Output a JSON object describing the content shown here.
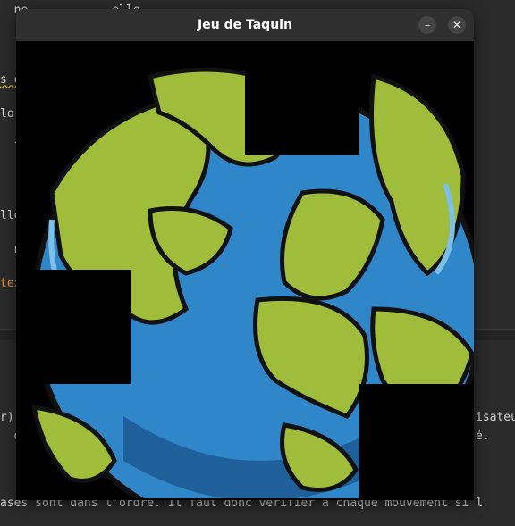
{
  "window": {
    "title": "Jeu de Taquin",
    "minimize_label": "–",
    "close_label": "✕"
  },
  "background_editor": {
    "lines": [
      "  ne            elle                ",
      "s é",
      "lor",
      "  la",
      "lle",
      "  ne",
      "tex",
      "r)",
      "  de",
      "isateu",
      "é.",
      "ases sont dans l'ordre. Il faut donc vérifier à chaque mouvement si l"
    ]
  },
  "board": {
    "grid": 4,
    "empty_index": 15,
    "tiles": [
      {
        "label": "tile-1"
      },
      {
        "label": "tile-2"
      },
      {
        "label": "tile-3"
      },
      {
        "label": "tile-4"
      },
      {
        "label": "tile-5"
      },
      {
        "label": "tile-6"
      },
      {
        "label": "tile-7"
      },
      {
        "label": "tile-8"
      },
      {
        "label": "tile-9"
      },
      {
        "label": "tile-10"
      },
      {
        "label": "tile-11"
      },
      {
        "label": "tile-12"
      },
      {
        "label": "tile-13"
      },
      {
        "label": "tile-14"
      },
      {
        "label": "tile-15"
      }
    ]
  },
  "colors": {
    "ocean": "#2f86c8",
    "ocean_dark": "#1f5f9a",
    "shore": "#7cc0e6",
    "land": "#9fbc3a",
    "outline": "#111111",
    "board_bg": "#000000"
  }
}
